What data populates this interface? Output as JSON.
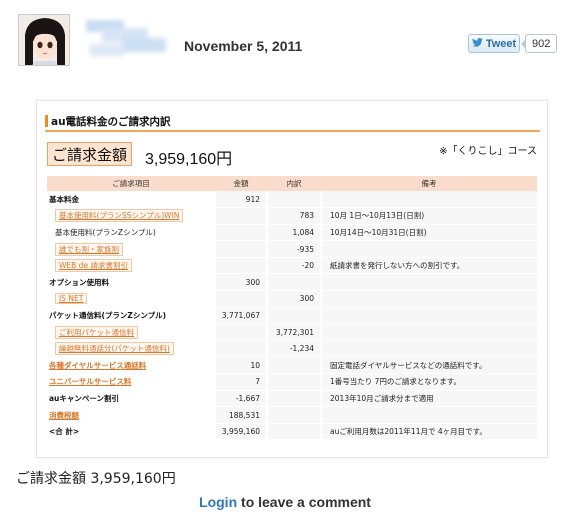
{
  "post": {
    "date": "November 5, 2011"
  },
  "share": {
    "tweet_label": "Tweet",
    "tweet_count": "902"
  },
  "document": {
    "title": "au電話料金のご請求内訳",
    "total_label": "ご請求金額",
    "total_amount": "3,959,160円",
    "course": "※「くりこし」コース",
    "columns": [
      "ご請求項目",
      "金額",
      "内訳",
      "備考"
    ],
    "rows": [
      {
        "item": "基本料金",
        "amount": "912",
        "detail": "",
        "note": ""
      },
      {
        "item": "基本使用料(プランSSシンプル)WIN",
        "amount": "",
        "detail": "783",
        "note": "10月 1日〜10月13日(日割)"
      },
      {
        "item": "基本使用料(プランZシンプル)",
        "amount": "",
        "detail": "1,084",
        "note": "10月14日〜10月31日(日割)"
      },
      {
        "item": "誰でも割・家族割",
        "amount": "",
        "detail": "-935",
        "note": ""
      },
      {
        "item": "WEB de 請求書割引",
        "amount": "",
        "detail": "-20",
        "note": "紙請求書を発行しない方への割引です。"
      },
      {
        "item": "オプション使用料",
        "amount": "300",
        "detail": "",
        "note": ""
      },
      {
        "item": "IS NET",
        "amount": "",
        "detail": "300",
        "note": ""
      },
      {
        "item": "パケット通信料(プランZシンプル)",
        "amount": "3,771,067",
        "detail": "",
        "note": ""
      },
      {
        "item": "ご利用パケット通信料",
        "amount": "",
        "detail": "3,772,301",
        "note": ""
      },
      {
        "item": "繰越無料通話分(パケット通信料)",
        "amount": "",
        "detail": "-1,234",
        "note": ""
      },
      {
        "item": "各種ダイヤルサービス通話料",
        "amount": "10",
        "detail": "",
        "note": "固定電話ダイヤルサービスなどの通話料です。"
      },
      {
        "item": "ユニバーサルサービス料",
        "amount": "7",
        "detail": "",
        "note": "1番号当たり 7円のご請求となります。"
      },
      {
        "item": "auキャンペーン割引",
        "amount": "-1,667",
        "detail": "",
        "note": "2013年10月ご請求分まで適用"
      },
      {
        "item": "消費税額",
        "amount": "188,531",
        "detail": "",
        "note": ""
      },
      {
        "item": "<合 計>",
        "amount": "3,959,160",
        "detail": "",
        "note": "auご利用月数は2011年11月で 4ヶ月目です。"
      }
    ]
  },
  "caption": "ご請求金額 3,959,160円",
  "comment": {
    "login_link": "Login",
    "rest": " to leave a comment"
  }
}
